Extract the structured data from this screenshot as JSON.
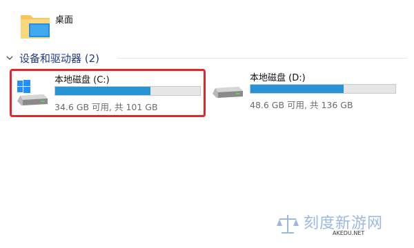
{
  "desktop": {
    "label": "桌面",
    "icon": "folder-desktop-icon"
  },
  "section": {
    "title": "设备和驱动器 (2)",
    "icon": "chevron-down-icon"
  },
  "drives": [
    {
      "name": "本地磁盘 (C:)",
      "info": "34.6 GB 可用, 共 101 GB",
      "used_fraction": 0.657,
      "icon": "windows-drive-icon",
      "selected_highlight": true
    },
    {
      "name": "本地磁盘 (D:)",
      "info": "48.6 GB 可用, 共 136 GB",
      "used_fraction": 0.643,
      "icon": "drive-icon",
      "selected_highlight": false
    }
  ],
  "watermark": {
    "title": "刻度新游网",
    "subtitle": "AKEDU.NET"
  },
  "colors": {
    "accent": "#2693d4",
    "highlight_border": "#e0262a",
    "section_title": "#1f3a8a"
  }
}
